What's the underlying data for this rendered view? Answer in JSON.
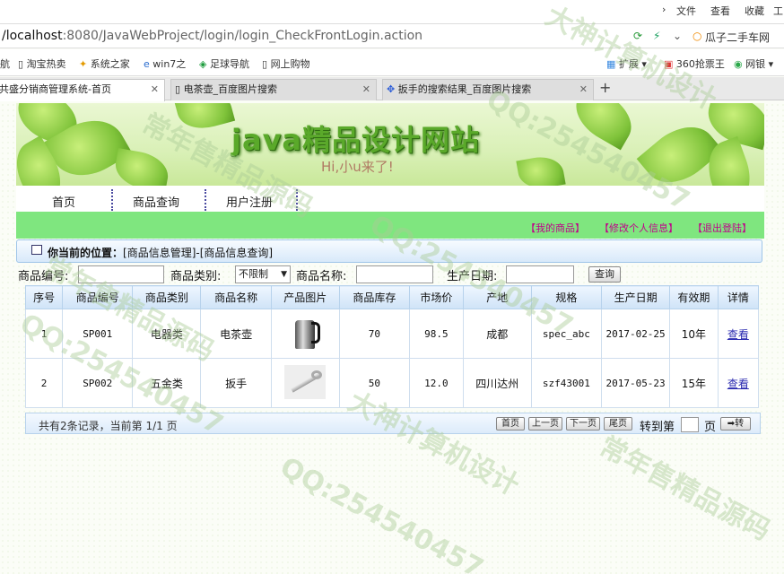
{
  "browser": {
    "menu": {
      "file": "文件",
      "view": "查看",
      "favorites": "收藏",
      "tools": "工"
    },
    "url_host": "/localhost",
    "url_rest": ":8080/JavaWebProject/login/login_CheckFrontLogin.action",
    "search_hint": "瓜子二手车网",
    "bookmarks": [
      "航",
      "淘宝热卖",
      "系统之家",
      "win7之",
      "足球导航",
      "网上购物"
    ],
    "bookmarks_right": [
      "扩展",
      "360抢票王",
      "网银"
    ],
    "tabs": [
      {
        "label": "共盛分销商管理系统-首页"
      },
      {
        "label": "电茶壶_百度图片搜索"
      },
      {
        "label": "扳手的搜索结果_百度图片搜索"
      }
    ],
    "new_tab": "+"
  },
  "banner": {
    "title": "java精品设计网站",
    "subtitle": "Hi,小u来了!"
  },
  "nav": {
    "items": [
      "首页",
      "商品查询",
      "用户注册"
    ]
  },
  "user_links": [
    "【我的商品】",
    "【修改个人信息】",
    "【退出登陆】"
  ],
  "position": {
    "label": "你当前的位置：",
    "path": "[商品信息管理]-[商品信息查询]"
  },
  "search": {
    "code_label": "商品编号:",
    "type_label": "商品类别:",
    "type_value": "不限制",
    "name_label": "商品名称:",
    "date_label": "生产日期:",
    "query_button": "查询"
  },
  "table": {
    "headers": [
      "序号",
      "商品编号",
      "商品类别",
      "商品名称",
      "产品图片",
      "商品库存",
      "市场价",
      "产地",
      "规格",
      "生产日期",
      "有效期",
      "详情"
    ],
    "rows": [
      {
        "no": "1",
        "code": "SP001",
        "type": "电器类",
        "name": "电茶壶",
        "image": "kettle",
        "stock": "70",
        "price": "98.5",
        "origin": "成都",
        "spec": "spec_abc",
        "date": "2017-02-25",
        "valid": "10年",
        "detail": "查看"
      },
      {
        "no": "2",
        "code": "SP002",
        "type": "五金类",
        "name": "扳手",
        "image": "wrench",
        "stock": "50",
        "price": "12.0",
        "origin": "四川达州",
        "spec": "szf43001",
        "date": "2017-05-23",
        "valid": "15年",
        "detail": "查看"
      }
    ]
  },
  "pager": {
    "summary": "共有2条记录，当前第 1/1 页",
    "first": "首页",
    "prev": "上一页",
    "next": "下一页",
    "last": "尾页",
    "jump_label": "转到第",
    "page_unit": "页",
    "go": "➡转"
  },
  "watermarks": [
    "QQ:254540457",
    "大神计算机设计",
    "常年售精品源码"
  ],
  "colors": {
    "nav_green": "#7fe67f",
    "link_magenta": "#c0008a",
    "title_green": "#5aa92a"
  }
}
